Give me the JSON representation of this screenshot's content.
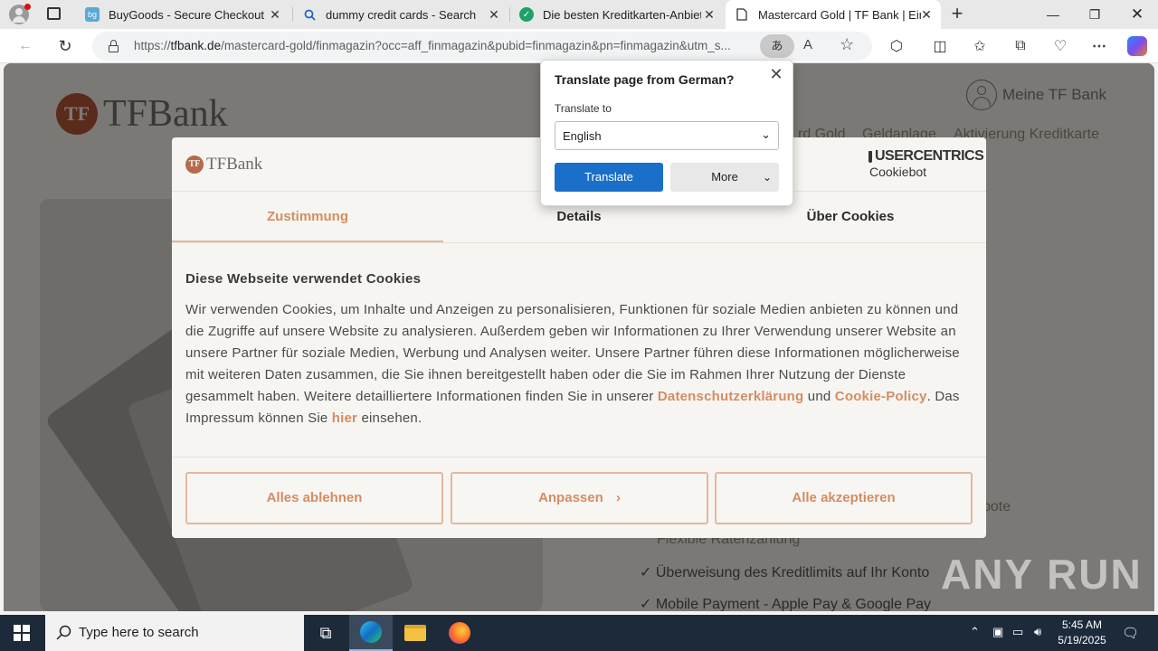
{
  "browser": {
    "tabs": [
      {
        "title": "BuyGoods - Secure Checkout",
        "icon": "buygoods-icon"
      },
      {
        "title": "dummy credit cards - Search",
        "icon": "search-icon"
      },
      {
        "title": "Die besten Kreditkarten-Anbieter",
        "icon": "check-icon"
      },
      {
        "title": "Mastercard Gold | TF Bank | Einfa",
        "icon": "page-icon"
      }
    ],
    "url_host": "tfbank.de",
    "url_prefix": "https://",
    "url_rest": "/mastercard-gold/finmagazin?occ=aff_finmagazin&pubid=finmagazin&pn=finmagazin&utm_s..."
  },
  "site": {
    "logo_text": "TFBank",
    "account_label": "Meine TF Bank",
    "nav": [
      "rd Gold",
      "Geldanlage",
      "Aktivierung Kreditkarte"
    ],
    "features": [
      "bote",
      "Flexible Ratenzahlung",
      "✓ Überweisung des Kreditlimits auf Ihr Konto",
      "✓ Mobile Payment - Apple Pay & Google Pay"
    ]
  },
  "cookie": {
    "logo_text": "TFBank",
    "brand_top": "USERCENTRICS",
    "brand_bottom": "Cookiebot",
    "tabs": [
      "Zustimmung",
      "Details",
      "Über Cookies"
    ],
    "title": "Diese Webseite verwendet Cookies",
    "text_1": "Wir verwenden Cookies, um Inhalte und Anzeigen zu personalisieren, Funktionen für soziale Medien anbieten zu können und die Zugriffe auf unsere Website zu analysieren. Außerdem geben wir Informationen zu Ihrer Verwendung unserer Website an unsere Partner für soziale Medien, Werbung und Analysen weiter. Unsere Partner führen diese Informationen möglicherweise mit weiteren Daten zusammen, die Sie ihnen bereitgestellt haben oder die Sie im Rahmen Ihrer Nutzung der Dienste gesammelt haben. Weitere detailliertere Informationen finden Sie in unserer ",
    "link_privacy": "Datenschutzerklärung",
    "text_and": " und ",
    "link_cookie_policy": "Cookie-Policy",
    "text_2": ". Das Impressum können Sie ",
    "link_here": "hier",
    "text_3": " einsehen.",
    "btn_reject": "Alles ablehnen",
    "btn_customize": "Anpassen",
    "btn_accept": "Alle akzeptieren"
  },
  "translate": {
    "title": "Translate page from German?",
    "label": "Translate to",
    "selected_language": "English",
    "btn_translate": "Translate",
    "btn_more": "More"
  },
  "taskbar": {
    "search_placeholder": "Type here to search",
    "time": "5:45 AM",
    "date": "5/19/2025"
  },
  "watermark": "ANY RUN"
}
